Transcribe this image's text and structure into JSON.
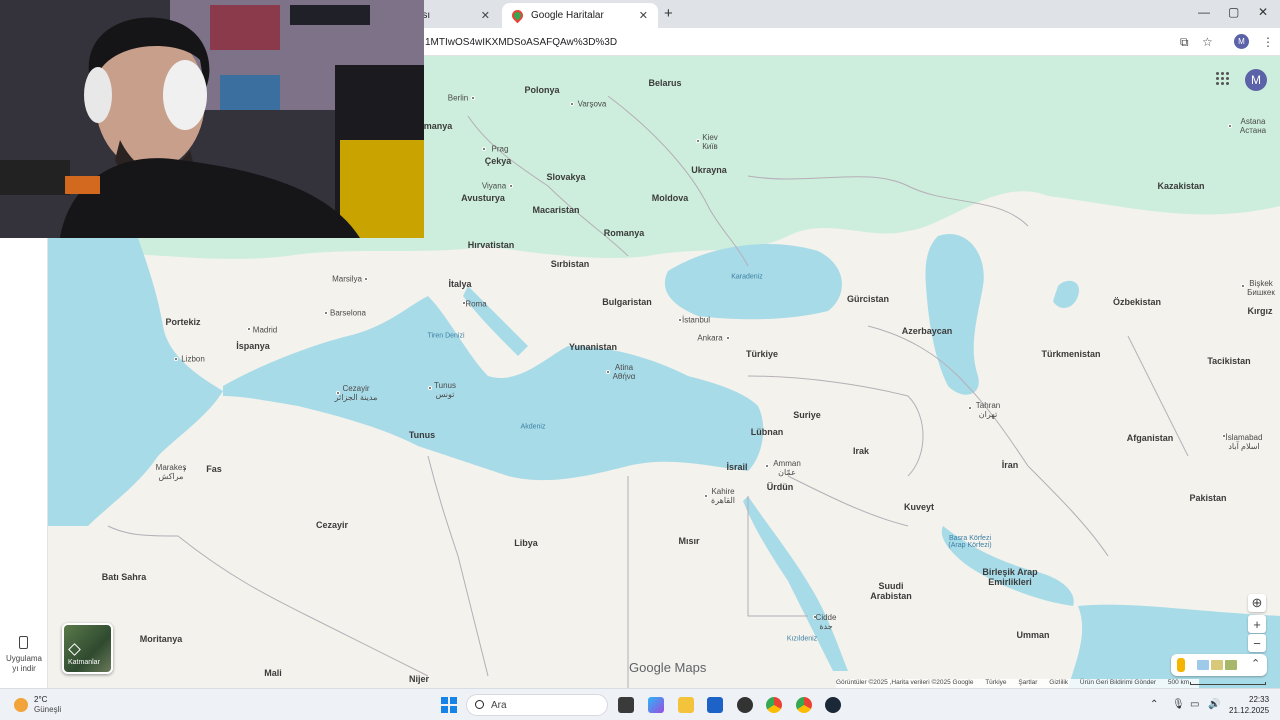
{
  "browser": {
    "tabs": [
      {
        "label": "tası",
        "close": "✕"
      },
      {
        "label": "Google Haritalar",
        "close": "✕"
      }
    ],
    "new_tab": "+",
    "url": "1MTIwOS4wIKXMDSoASAFQAw%3D%3D",
    "window_controls": [
      "—",
      "▢",
      "✕"
    ],
    "profile_initial": "M"
  },
  "map": {
    "countries": [
      {
        "name": "Belarus"
      },
      {
        "name": "Polonya"
      },
      {
        "name": "manya"
      },
      {
        "name": "Çekya"
      },
      {
        "name": "Slovakya"
      },
      {
        "name": "Ukrayna"
      },
      {
        "name": "Avusturya"
      },
      {
        "name": "Macaristan"
      },
      {
        "name": "Moldova"
      },
      {
        "name": "Romanya"
      },
      {
        "name": "Hırvatistan"
      },
      {
        "name": "Sırbistan"
      },
      {
        "name": "İtalya"
      },
      {
        "name": "Bulgaristan"
      },
      {
        "name": "Kazakistan"
      },
      {
        "name": "Özbekistan"
      },
      {
        "name": "Kırgız"
      },
      {
        "name": "Gürcistan"
      },
      {
        "name": "Azerbaycan"
      },
      {
        "name": "Türkmenistan"
      },
      {
        "name": "Tacikistan"
      },
      {
        "name": "Portekiz"
      },
      {
        "name": "İspanya"
      },
      {
        "name": "Yunanistan"
      },
      {
        "name": "Türkiye"
      },
      {
        "name": "Suriye"
      },
      {
        "name": "Lübnan"
      },
      {
        "name": "Irak"
      },
      {
        "name": "İran"
      },
      {
        "name": "Afganistan"
      },
      {
        "name": "Pakistan"
      },
      {
        "name": "İsrail"
      },
      {
        "name": "Ürdün"
      },
      {
        "name": "Kuveyt"
      },
      {
        "name": "Fas"
      },
      {
        "name": "Tunus"
      },
      {
        "name": "Cezayir"
      },
      {
        "name": "Libya"
      },
      {
        "name": "Mısır"
      },
      {
        "name": "Suudi\nArabistan"
      },
      {
        "name": "Birleşik Arap\nEmirlikleri"
      },
      {
        "name": "Batı Sahra"
      },
      {
        "name": "Moritanya"
      },
      {
        "name": "Mali"
      },
      {
        "name": "Nijer"
      },
      {
        "name": "Umman"
      }
    ],
    "cities": [
      {
        "name": "Berlin"
      },
      {
        "name": "Varşova"
      },
      {
        "name": "Kiev\nКиїв"
      },
      {
        "name": "Prag"
      },
      {
        "name": "Viyana"
      },
      {
        "name": "Astana\nАстана"
      },
      {
        "name": "Bişkek\nБишкек"
      },
      {
        "name": "Marsilya"
      },
      {
        "name": "Barselona"
      },
      {
        "name": "Madrid"
      },
      {
        "name": "Roma"
      },
      {
        "name": "Lizbon"
      },
      {
        "name": "İstanbul"
      },
      {
        "name": "Ankara"
      },
      {
        "name": "Atina\nΑθήνα"
      },
      {
        "name": "Cezayir\nمدينة الجزائر"
      },
      {
        "name": "Tunus\nتونس"
      },
      {
        "name": "Tahran\nتهران"
      },
      {
        "name": "Amman\nعمّان"
      },
      {
        "name": "Kahire\nالقاهرة"
      },
      {
        "name": "İslamabad\nاسلام آباد"
      },
      {
        "name": "Marakeş\nمراكش"
      },
      {
        "name": "Cidde\nجدة"
      }
    ],
    "seas": [
      {
        "name": "Karadeniz"
      },
      {
        "name": "Tiren Denizi"
      },
      {
        "name": "Akdeniz"
      },
      {
        "name": "Basra Körfezi\n(Arap Körfezi)"
      },
      {
        "name": "Kızıldeniz"
      }
    ],
    "brand": "Google Maps",
    "layers_label": "Katmanlar",
    "app_download": "Uygulama\nyı indir",
    "attribution": [
      "Görüntüler ©2025 ,Harita verileri ©2025 Google",
      "Türkiye",
      "Şartlar",
      "Gizlilik",
      "Ürün Geri Bildirimi Gönder",
      "500 km"
    ],
    "avatar_initial": "M",
    "zoom_in": "+",
    "zoom_out": "−"
  },
  "taskbar": {
    "temperature": "2°C",
    "condition": "Güneşli",
    "search_placeholder": "Ara",
    "time": "22:33",
    "date": "21.12.2025"
  },
  "colors": {
    "water": "#a8dbe8",
    "land": "#f4f2ec",
    "vegetation": "#c8ead4",
    "accent": "#5b62a8"
  }
}
